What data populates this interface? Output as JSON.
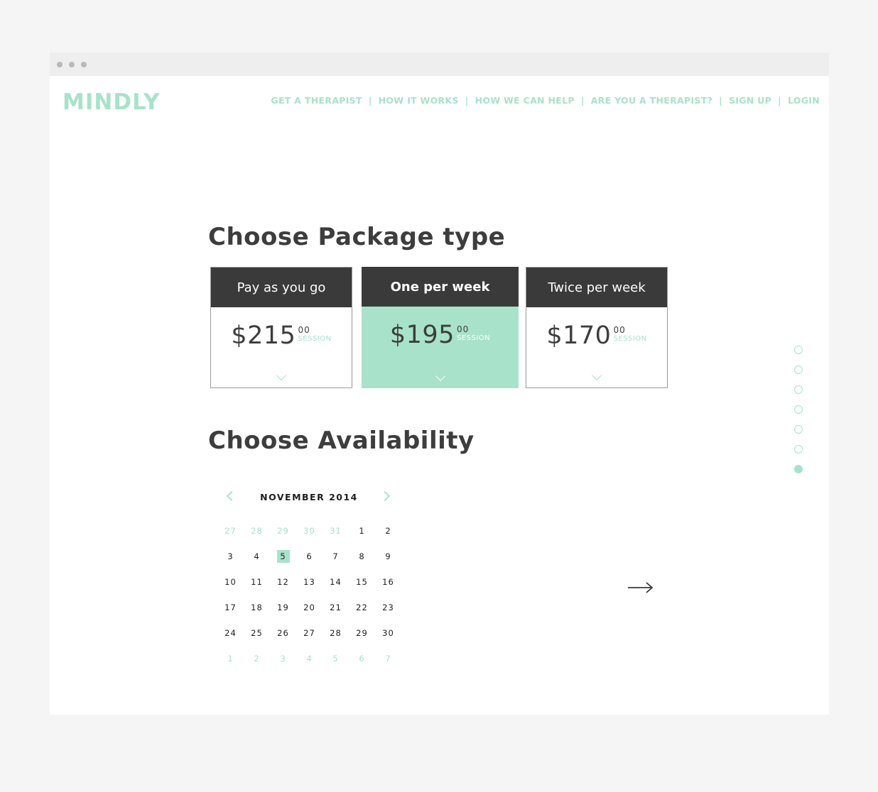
{
  "brand": {
    "name": "MINDLY",
    "color": "#a8e2ca"
  },
  "nav": [
    "GET A THERAPIST",
    "HOW IT WORKS",
    "HOW WE CAN HELP",
    "ARE YOU A THERAPIST?",
    "SIGN UP",
    "LOGIN"
  ],
  "package_section": {
    "title": "Choose Package type"
  },
  "packages": [
    {
      "name": "Pay as you go",
      "price": "$215",
      "cents": "00",
      "unit": "SESSION",
      "selected": false
    },
    {
      "name": "One per week",
      "price": "$195",
      "cents": "00",
      "unit": "SESSION",
      "selected": true
    },
    {
      "name": "Twice per week",
      "price": "$170",
      "cents": "00",
      "unit": "SESSION",
      "selected": false
    }
  ],
  "availability_section": {
    "title": "Choose Availability"
  },
  "calendar": {
    "month_label": "NOVEMBER 2014",
    "weeks": [
      [
        "27",
        "28",
        "29",
        "30",
        "31",
        "1",
        "2"
      ],
      [
        "3",
        "4",
        "5",
        "6",
        "7",
        "8",
        "9"
      ],
      [
        "10",
        "11",
        "12",
        "13",
        "14",
        "15",
        "16"
      ],
      [
        "17",
        "18",
        "19",
        "20",
        "21",
        "22",
        "23"
      ],
      [
        "24",
        "25",
        "26",
        "27",
        "28",
        "29",
        "30"
      ],
      [
        "1",
        "2",
        "3",
        "4",
        "5",
        "6",
        "7"
      ]
    ],
    "muted": [
      [
        true,
        true,
        true,
        true,
        true,
        false,
        false
      ],
      [
        false,
        false,
        false,
        false,
        false,
        false,
        false
      ],
      [
        false,
        false,
        false,
        false,
        false,
        false,
        false
      ],
      [
        false,
        false,
        false,
        false,
        false,
        false,
        false
      ],
      [
        false,
        false,
        false,
        false,
        false,
        false,
        false
      ],
      [
        true,
        true,
        true,
        true,
        true,
        true,
        true
      ]
    ],
    "selected_day": "5"
  },
  "progress": {
    "total_steps": 7,
    "current_step": 7
  },
  "icons": {
    "prev": "chevron-left-icon",
    "next": "chevron-right-icon",
    "expand": "chevron-down-icon",
    "continue": "arrow-right-icon"
  }
}
